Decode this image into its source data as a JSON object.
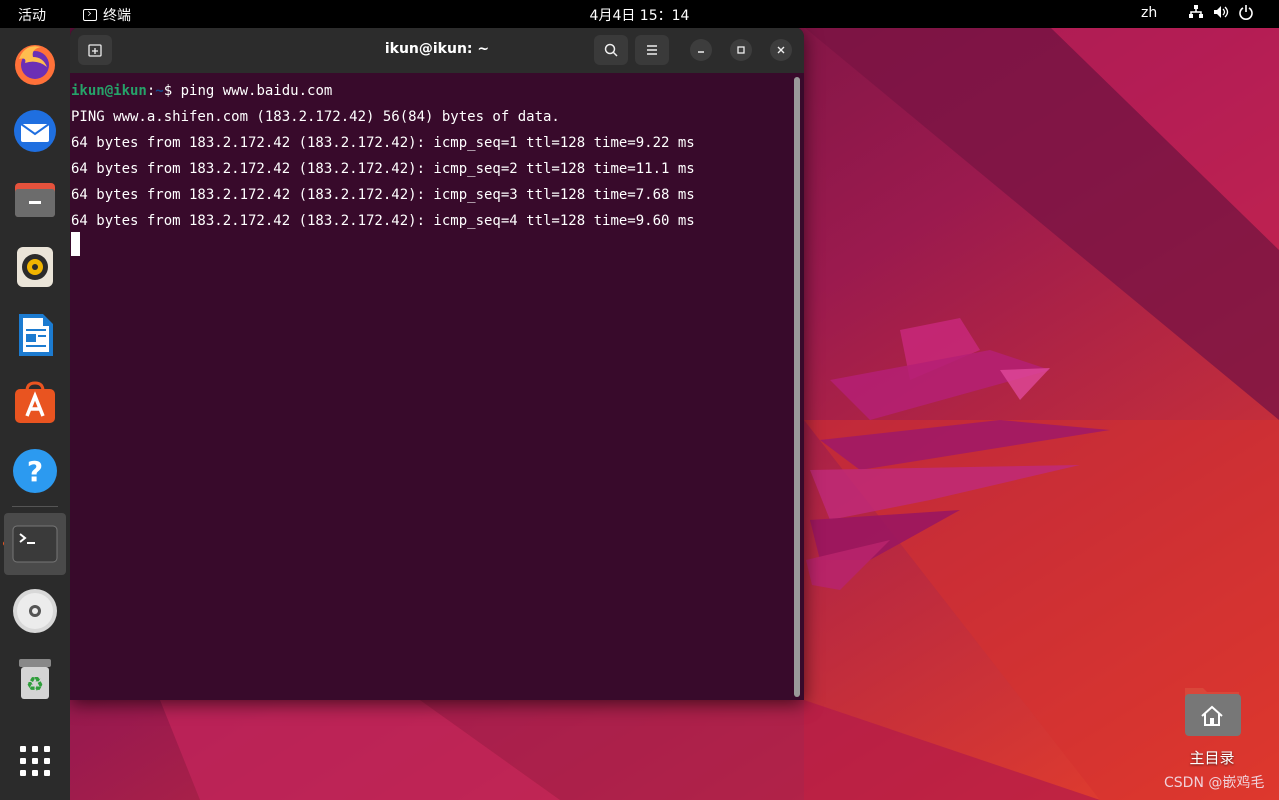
{
  "topbar": {
    "activities": "活动",
    "app_name": "终端",
    "clock": "4月4日  15：14",
    "lang": "zh",
    "tray_icons": [
      "network-icon",
      "volume-icon",
      "power-icon"
    ]
  },
  "dock": {
    "items": [
      {
        "name": "firefox",
        "icon": "firefox-icon"
      },
      {
        "name": "thunderbird",
        "icon": "mail-icon"
      },
      {
        "name": "files",
        "icon": "files-icon"
      },
      {
        "name": "rhythmbox",
        "icon": "speaker-icon"
      },
      {
        "name": "libreoffice-writer",
        "icon": "document-icon"
      },
      {
        "name": "app-center",
        "icon": "app-store-icon"
      },
      {
        "name": "help",
        "icon": "help-icon"
      },
      {
        "name": "terminal",
        "icon": "terminal-icon",
        "running": true
      },
      {
        "name": "disc",
        "icon": "disc-icon"
      },
      {
        "name": "trash",
        "icon": "trash-icon"
      },
      {
        "name": "show-apps",
        "icon": "grid-icon"
      }
    ]
  },
  "terminal": {
    "title": "ikun@ikun: ~",
    "prompt_user": "ikun@ikun",
    "prompt_sep": ":",
    "prompt_path": "~",
    "prompt_dollar": "$ ",
    "command": "ping www.baidu.com",
    "output": [
      "PING www.a.shifen.com (183.2.172.42) 56(84) bytes of data.",
      "64 bytes from 183.2.172.42 (183.2.172.42): icmp_seq=1 ttl=128 time=9.22 ms",
      "64 bytes from 183.2.172.42 (183.2.172.42): icmp_seq=2 ttl=128 time=11.1 ms",
      "64 bytes from 183.2.172.42 (183.2.172.42): icmp_seq=3 ttl=128 time=7.68 ms",
      "64 bytes from 183.2.172.42 (183.2.172.42): icmp_seq=4 ttl=128 time=9.60 ms"
    ]
  },
  "desktop": {
    "home_label": "主目录",
    "watermark": "CSDN @嵌鸡毛"
  },
  "colors": {
    "terminal_bg": "#380a2b",
    "prompt_user": "#26a269",
    "prompt_path": "#12488b",
    "accent": "#e95420"
  }
}
